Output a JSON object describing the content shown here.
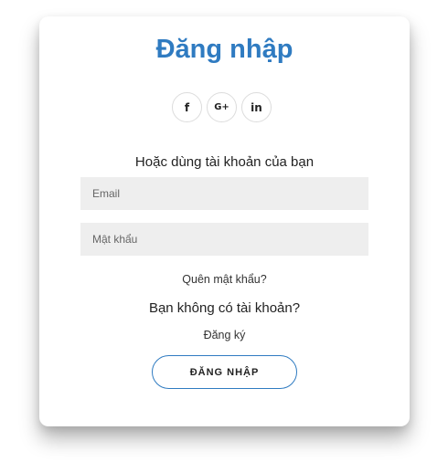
{
  "form": {
    "title": "Đăng nhập",
    "social_buttons": [
      {
        "label": "f",
        "icon": "facebook-icon"
      },
      {
        "label": "G+",
        "icon": "google-plus-icon"
      },
      {
        "label": "in",
        "icon": "linkedin-icon"
      }
    ],
    "alt_text": "Hoặc dùng tài khoản của bạn",
    "email_placeholder": "Email",
    "password_placeholder": "Mật khẩu",
    "forgot_password": "Quên mật khẩu?",
    "no_account": "Bạn không có tài khoản?",
    "register": "Đăng ký",
    "submit_label": "ĐĂNG NHẬP"
  },
  "colors": {
    "accent": "#2f7bc1",
    "input_bg": "#eeeeee"
  }
}
